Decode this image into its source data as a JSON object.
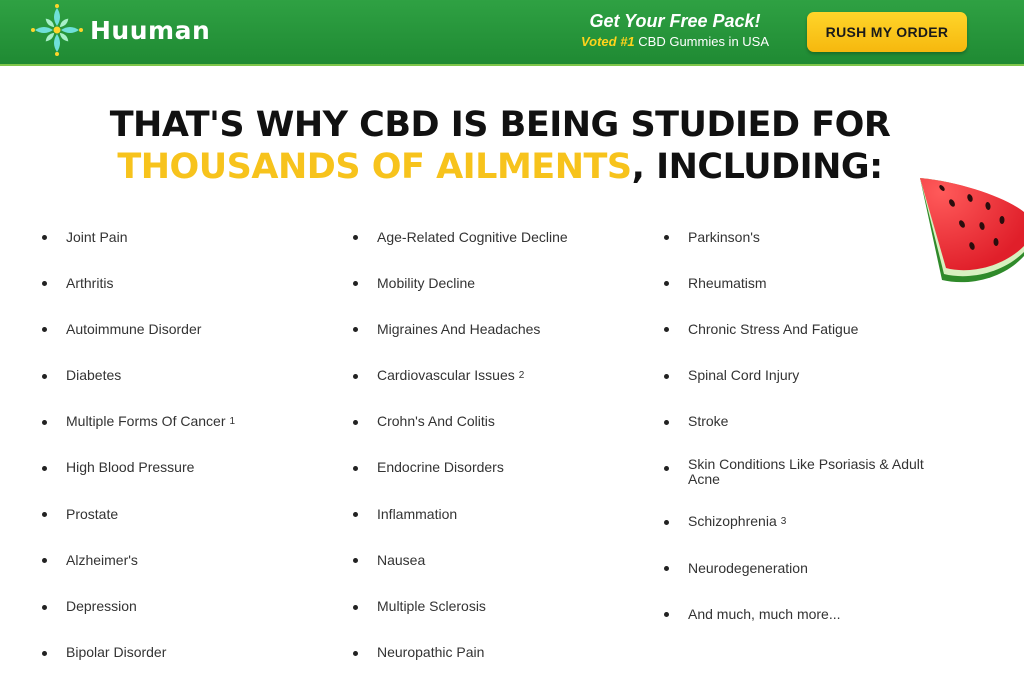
{
  "header": {
    "brand": "Huuman",
    "promo_title": "Get Your Free Pack!",
    "promo_highlight": "Voted #1",
    "promo_rest": " CBD Gummies in USA",
    "cta_label": "RUSH MY ORDER"
  },
  "headline": {
    "line1": "THAT'S WHY CBD IS BEING STUDIED FOR",
    "line2_highlight": "THOUSANDS OF AILMENTS",
    "line2_rest": ", INCLUDING:"
  },
  "colors": {
    "header_green": "#2fa143",
    "highlight_yellow": "#fcce1a",
    "headline_yellow": "#f7c31c"
  },
  "ailments": {
    "col1": [
      {
        "label": "Joint Pain",
        "highlighted": false,
        "ref": ""
      },
      {
        "label": "Arthritis",
        "highlighted": true,
        "ref": ""
      },
      {
        "label": "Autoimmune Disorder",
        "highlighted": false,
        "ref": ""
      },
      {
        "label": "Diabetes",
        "highlighted": true,
        "ref": ""
      },
      {
        "label": "Multiple Forms Of Cancer",
        "highlighted": false,
        "ref": "1"
      },
      {
        "label": "High Blood Pressure",
        "highlighted": false,
        "ref": ""
      },
      {
        "label": "Prostate",
        "highlighted": false,
        "ref": ""
      },
      {
        "label": "Alzheimer's",
        "highlighted": true,
        "ref": ""
      },
      {
        "label": "Depression",
        "highlighted": false,
        "ref": ""
      },
      {
        "label": "Bipolar Disorder",
        "highlighted": false,
        "ref": ""
      }
    ],
    "col2": [
      {
        "label": "Age-Related Cognitive Decline",
        "highlighted": true,
        "ref": ""
      },
      {
        "label": "Mobility Decline",
        "highlighted": true,
        "ref": ""
      },
      {
        "label": "Migraines And Headaches",
        "highlighted": false,
        "ref": ""
      },
      {
        "label": "Cardiovascular Issues",
        "highlighted": false,
        "ref": "2"
      },
      {
        "label": "Crohn's And Colitis",
        "highlighted": false,
        "ref": ""
      },
      {
        "label": "Endocrine Disorders",
        "highlighted": false,
        "ref": ""
      },
      {
        "label": "Inflammation",
        "highlighted": true,
        "ref": ""
      },
      {
        "label": "Nausea",
        "highlighted": false,
        "ref": ""
      },
      {
        "label": "Multiple Sclerosis",
        "highlighted": false,
        "ref": ""
      },
      {
        "label": "Neuropathic Pain",
        "highlighted": true,
        "ref": ""
      }
    ],
    "col3": [
      {
        "label": "Parkinson's",
        "highlighted": false,
        "ref": ""
      },
      {
        "label": "Rheumatism",
        "highlighted": false,
        "ref": ""
      },
      {
        "label": "Chronic Stress And Fatigue",
        "highlighted": true,
        "ref": ""
      },
      {
        "label": "Spinal Cord Injury",
        "highlighted": false,
        "ref": ""
      },
      {
        "label": "Stroke",
        "highlighted": false,
        "ref": ""
      },
      {
        "label": "Skin Conditions Like Psoriasis & Adult Acne",
        "highlighted": false,
        "ref": ""
      },
      {
        "label": "Schizophrenia",
        "highlighted": false,
        "ref": "3"
      },
      {
        "label": "Neurodegeneration",
        "highlighted": false,
        "ref": ""
      },
      {
        "label": "And much, much more...",
        "highlighted": true,
        "ref": ""
      }
    ]
  }
}
